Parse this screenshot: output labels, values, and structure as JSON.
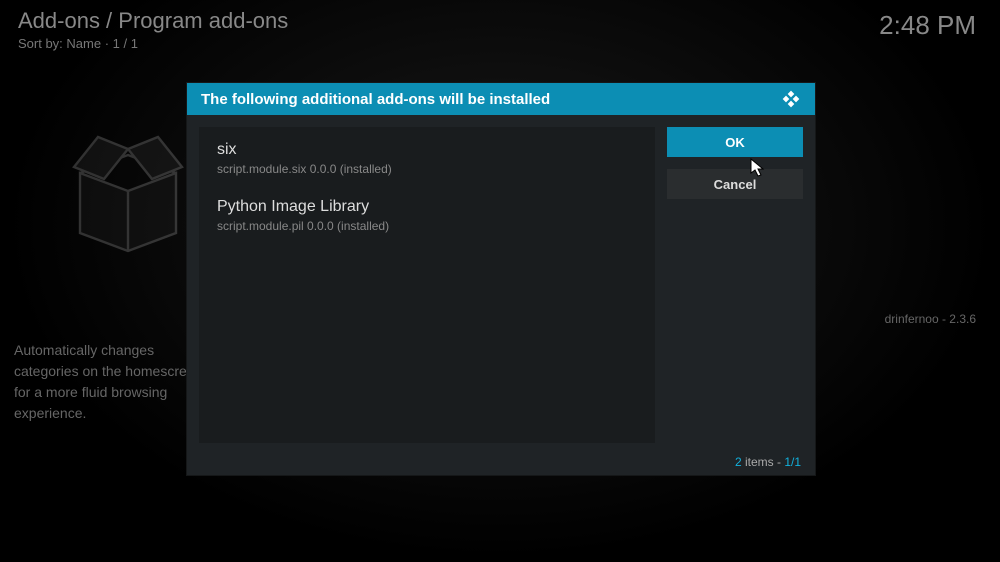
{
  "header": {
    "breadcrumb": "Add-ons / Program add-ons",
    "sort": "Sort by: Name  ·  1 / 1"
  },
  "clock": "2:48 PM",
  "background": {
    "author_version": "drinfernoo - 2.3.6",
    "description": "Automatically changes categories on the homescreen for a more fluid browsing experience."
  },
  "dialog": {
    "title": "The following additional add-ons will be installed",
    "addons": [
      {
        "name": "six",
        "script": "script.module.six 0.0.0 (installed)"
      },
      {
        "name": "Python Image Library",
        "script": "script.module.pil 0.0.0 (installed)"
      }
    ],
    "buttons": {
      "ok": "OK",
      "cancel": "Cancel"
    },
    "footer": {
      "count": "2",
      "items_label": " items - ",
      "page": "1/1"
    }
  }
}
